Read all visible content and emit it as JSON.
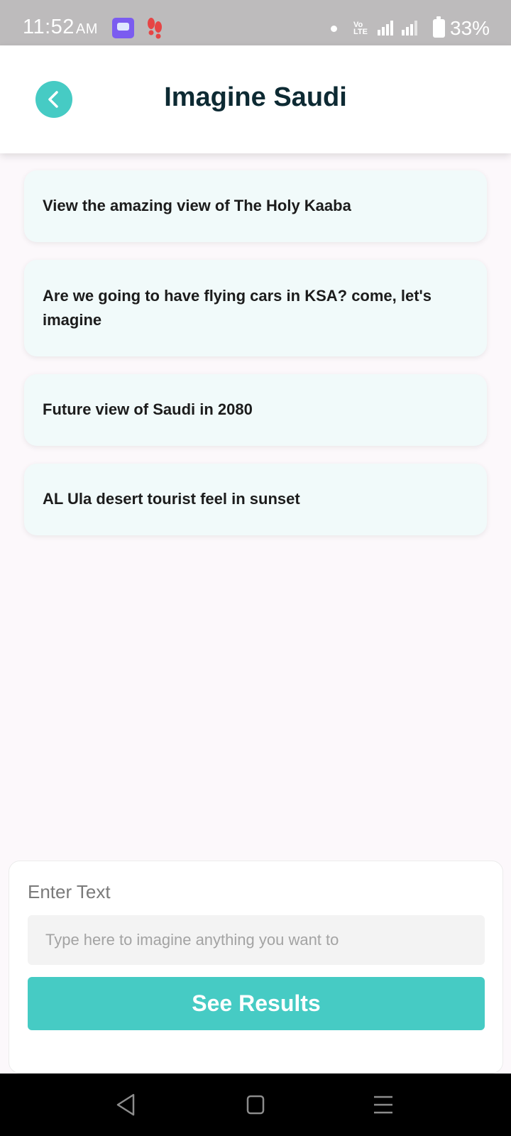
{
  "status_bar": {
    "time": "11:52",
    "ampm": "AM",
    "network_label": "Vo\nLTE",
    "battery": "33%",
    "icons": [
      "message-app-icon",
      "footsteps-icon",
      "notification-dot-icon",
      "volte-icon",
      "signal-icon",
      "battery-charging-icon"
    ]
  },
  "header": {
    "title": "Imagine Saudi",
    "back_icon": "chevron-left-icon",
    "accent_color": "#46cbc4"
  },
  "suggestions": [
    {
      "text": "View the amazing view of The Holy Kaaba"
    },
    {
      "text": "Are we going to have flying cars in KSA? come, let's imagine"
    },
    {
      "text": "Future view of Saudi in 2080"
    },
    {
      "text": "AL Ula desert tourist feel in sunset"
    }
  ],
  "input_panel": {
    "label": "Enter Text",
    "placeholder": "Type here to imagine anything you want to",
    "value": "",
    "button_label": "See Results"
  },
  "nav_bar": {
    "icons": [
      "back-triangle-icon",
      "home-square-icon",
      "recents-menu-icon"
    ]
  }
}
